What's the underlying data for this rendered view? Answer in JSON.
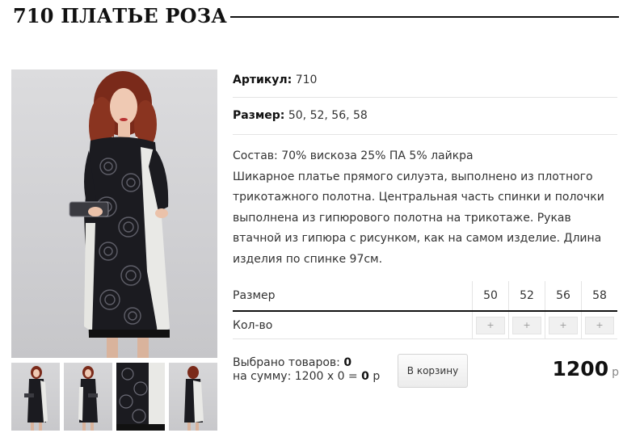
{
  "product": {
    "title": "710 ПЛАТЬЕ РОЗА",
    "sku_label": "Артикул:",
    "sku_value": "710",
    "size_label": "Размер:",
    "size_value": "50, 52, 56, 58",
    "description": [
      "Состав: 70% вискоза 25% ПА 5% лайкра",
      "Шикарное платье прямого силуэта, выполнено из плотного",
      "трикотажного полотна. Центральная часть спинки и полочки",
      "выполнена из гипюрового полотна на трикотаже. Рукав",
      "втачной из гипюра с рисунком, как на самом изделие. Длина",
      "изделия по спинке 97см."
    ]
  },
  "size_table": {
    "size_header": "Размер",
    "qty_label": "Кол-во",
    "sizes": [
      "50",
      "52",
      "56",
      "58"
    ],
    "plus_symbol": "+"
  },
  "summary": {
    "selected_label": "Выбрано товаров:",
    "selected_count": "0",
    "sum_label": "на сумму:",
    "sum_expression": "1200 х 0 =",
    "sum_total": "0",
    "sum_currency": "р"
  },
  "cart_button_label": "В корзину",
  "price": {
    "amount": "1200",
    "currency": "р"
  },
  "colors": {
    "accent": "#111111",
    "lace": "#1b1b20",
    "panel": "#e9e9e6"
  }
}
